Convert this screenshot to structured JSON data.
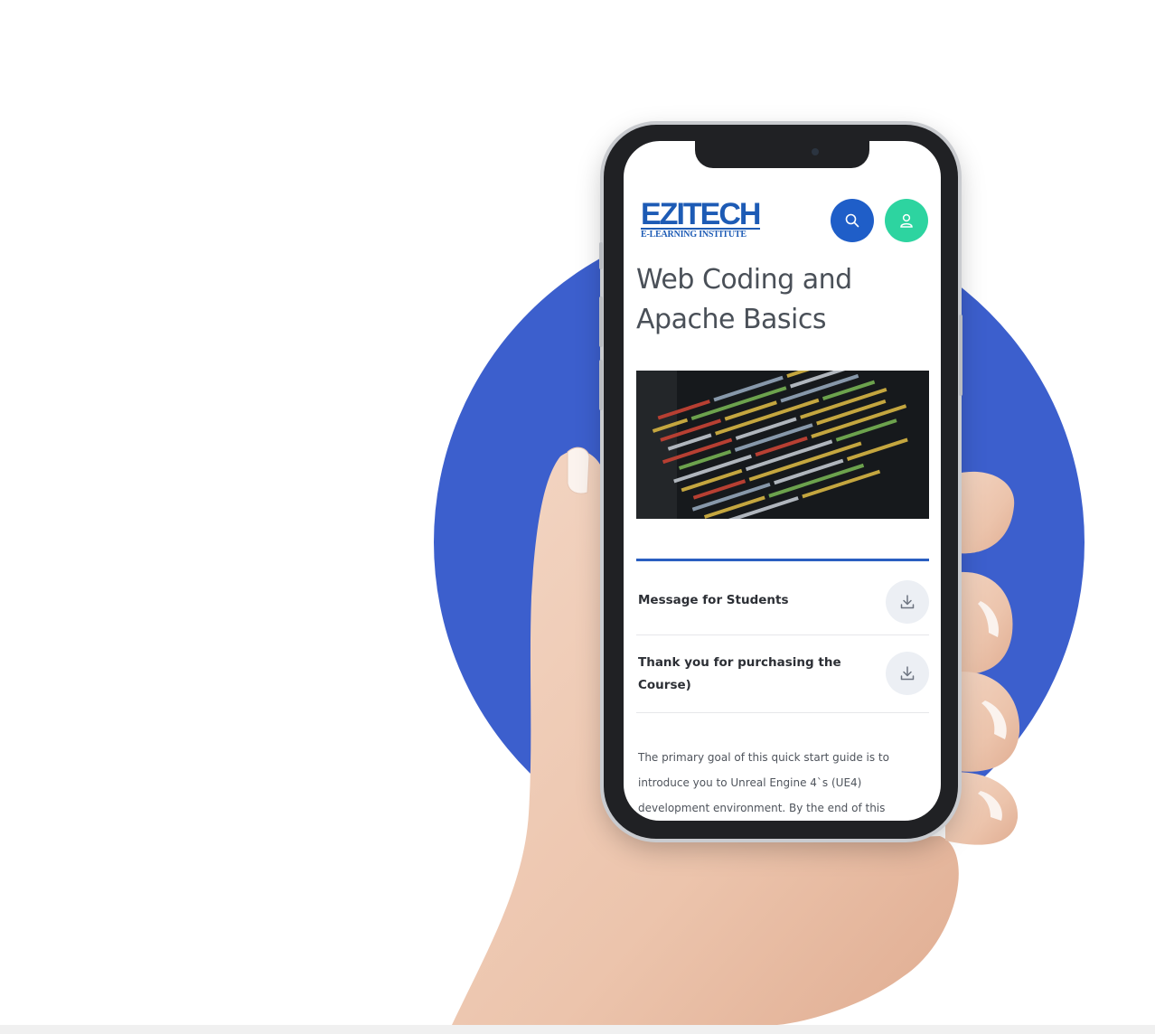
{
  "colors": {
    "accent": "#3c5fcd",
    "brand": "#1d5bb5",
    "search_button": "#1f5ec8",
    "user_button": "#2dd4a0"
  },
  "header": {
    "logo_main": "EZITECH",
    "logo_sub": "E-LEARNING INSTITUTE",
    "search_icon": "search-icon",
    "user_icon": "user-icon"
  },
  "course": {
    "title_line1": "Web Coding and",
    "title_line2": "Apache Basics",
    "hero_image": "code-on-screen"
  },
  "resources": [
    {
      "label": "Message for Students",
      "icon": "download-icon"
    },
    {
      "label": "Thank you for purchasing the Course)",
      "icon": "download-icon"
    }
  ],
  "description": {
    "line1": "The primary goal of this quick start guide is to",
    "line2": "introduce you to Unreal Engine 4`s (UE4)",
    "line3": "development environment. By the end of this"
  }
}
